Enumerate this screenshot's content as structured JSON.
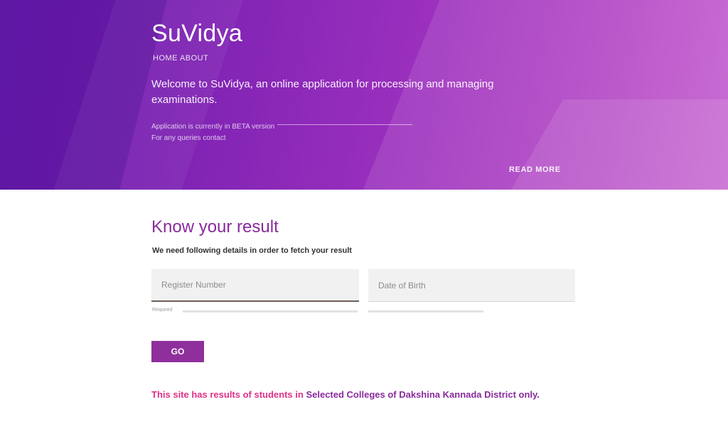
{
  "hero": {
    "title": "SuVidya",
    "subtitle": "HOME ABOUT",
    "description": "Welcome to SuVidya, an online application for processing and managing examinations.",
    "note_line_1": "Application is currently in BETA version",
    "note_line_2": "For any queries contact",
    "link_label": "READ MORE",
    "colors": {
      "gradient_start": "#6a1fb0",
      "gradient_end": "#c35cce"
    }
  },
  "result_section": {
    "title": "Know your result",
    "subtitle": "We need following details in order to fetch your result",
    "fields": [
      {
        "placeholder": "Register Number",
        "helper": "Required"
      },
      {
        "placeholder": "Date of Birth",
        "helper": ""
      }
    ],
    "submit_label": "GO",
    "disclaimer_highlight": "This site has results of students in",
    "disclaimer_rest": "Selected Colleges of Dakshina Kannada District only.",
    "colors": {
      "accent": "#8a2a9b",
      "button": "#8f2f9c",
      "highlight": "#e0308a"
    }
  }
}
